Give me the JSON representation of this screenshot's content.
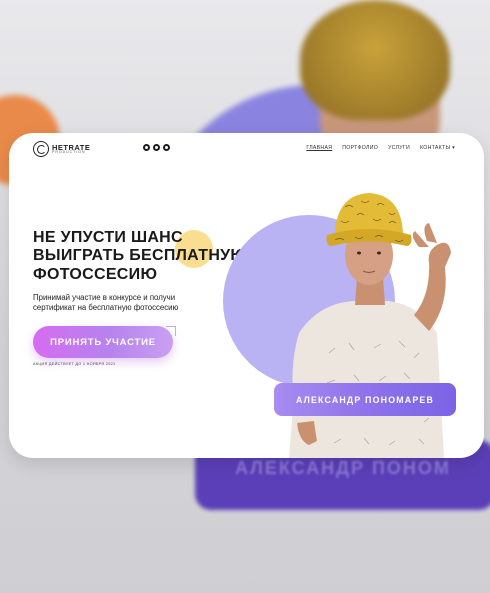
{
  "brand": {
    "name": "HETRATE",
    "sub": "PRODUCTION"
  },
  "socials": [
    "youtube-icon",
    "instagram-icon",
    "vk-icon"
  ],
  "nav": [
    {
      "label": "ГЛАВНАЯ",
      "active": true
    },
    {
      "label": "ПОРТФОЛИО",
      "active": false
    },
    {
      "label": "УСЛУГИ",
      "active": false
    },
    {
      "label": "КОНТАКТЫ ▾",
      "active": false
    }
  ],
  "hero": {
    "headline": [
      "НЕ УПУСТИ ШАНС",
      "ВЫИГРАТЬ БЕСПЛАТНУЮ",
      "ФОТОССЕСИЮ"
    ],
    "subtext": "Принимай участие в конкурсе и получи сертификат на бесплатную фотоссесию",
    "cta_label": "ПРИНЯТЬ УЧАСТИЕ",
    "promo_note": "АКЦИЯ ДЕЙСТВУЕТ ДО 1 НОЯБРЯ 2021"
  },
  "model": {
    "name": "АЛЕКСАНДР ПОНОМАРЕВ"
  },
  "backdrop": {
    "blurred_name": "АЛЕКСАНДР ПОНОМ"
  },
  "colors": {
    "accent_purple": "#8e73eb",
    "cta_pink": "#d66cf0",
    "circle_lavender": "#b9b2f3",
    "yellow": "#f9d87c"
  }
}
